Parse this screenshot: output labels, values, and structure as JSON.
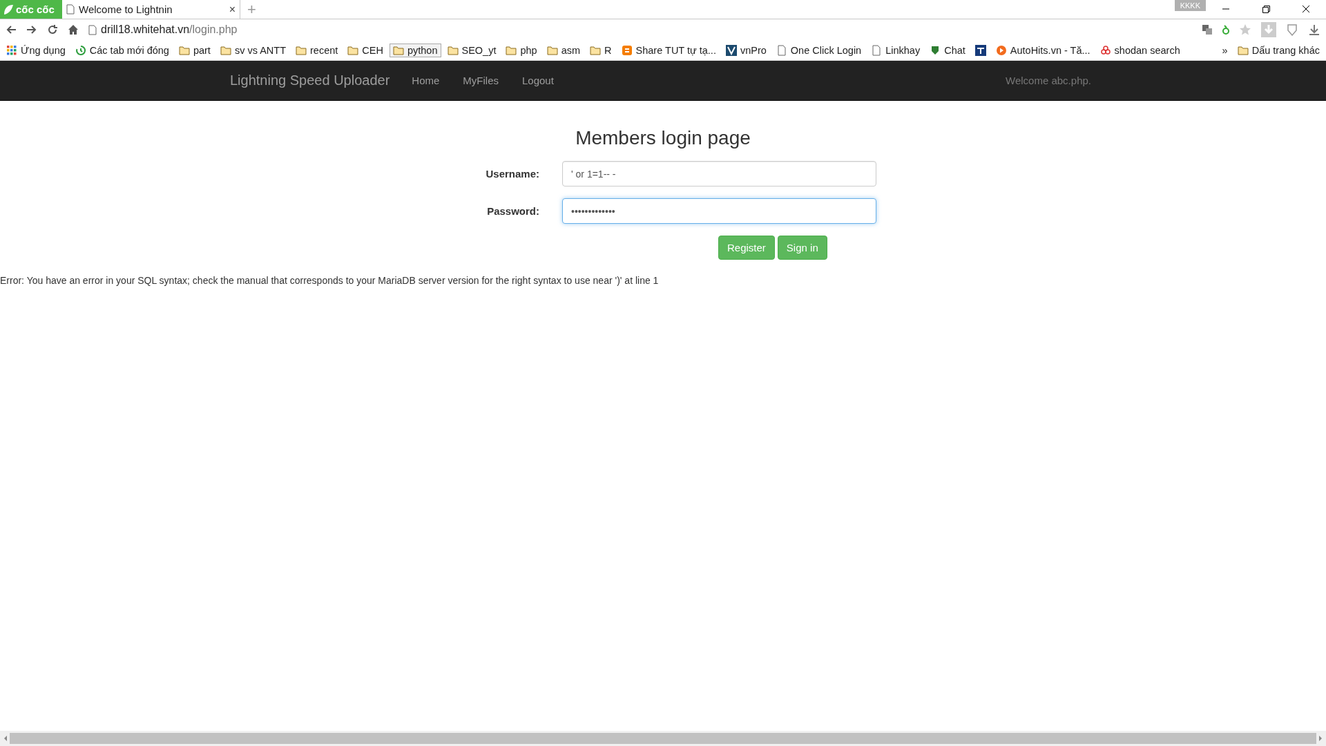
{
  "browser": {
    "logo": "cốc cốc",
    "tab": {
      "title": "Welcome to Lightnin",
      "close": "×"
    },
    "new_tab": "+",
    "profile": "KKKK",
    "address": {
      "host": "drill18.whitehat.vn",
      "path": "/login.php"
    }
  },
  "bookmarks": [
    {
      "kind": "apps",
      "label": "Ứng dụng",
      "selected": false
    },
    {
      "kind": "history",
      "label": "Các tab mới đóng",
      "selected": false
    },
    {
      "kind": "folder",
      "label": "part",
      "selected": false
    },
    {
      "kind": "folder",
      "label": "sv vs ANTT",
      "selected": false
    },
    {
      "kind": "folder",
      "label": "recent",
      "selected": false
    },
    {
      "kind": "folder",
      "label": "CEH",
      "selected": false
    },
    {
      "kind": "folder",
      "label": "python",
      "selected": true
    },
    {
      "kind": "folder",
      "label": "SEO_yt",
      "selected": false
    },
    {
      "kind": "folder",
      "label": "php",
      "selected": false
    },
    {
      "kind": "folder",
      "label": "asm",
      "selected": false
    },
    {
      "kind": "folder",
      "label": "R",
      "selected": false
    },
    {
      "kind": "blogger",
      "label": "Share TUT tự tạ...",
      "selected": false
    },
    {
      "kind": "vnpro",
      "label": "vnPro",
      "selected": false
    },
    {
      "kind": "page",
      "label": "One Click Login",
      "selected": false
    },
    {
      "kind": "page",
      "label": "Linkhay",
      "selected": false
    },
    {
      "kind": "shield",
      "label": "Chat",
      "selected": false
    },
    {
      "kind": "tp",
      "selected": false
    },
    {
      "kind": "play",
      "label": "AutoHits.vn - Tă...",
      "selected": false
    },
    {
      "kind": "shodan",
      "label": "shodan search",
      "selected": false
    }
  ],
  "bookmarks_more": "»",
  "other_bookmarks": "Dấu trang khác",
  "navbar": {
    "brand": "Lightning Speed Uploader",
    "links": [
      "Home",
      "MyFiles",
      "Logout"
    ],
    "welcome": "Welcome abc.php."
  },
  "login": {
    "title": "Members login page",
    "fields": [
      {
        "label": "Username:",
        "value": "' or 1=1-- -",
        "focused": false
      },
      {
        "label": "Password:",
        "value": "•••••••••••••",
        "focused": true
      }
    ],
    "buttons": [
      "Register",
      "Sign in"
    ]
  },
  "error": "Error: You have an error in your SQL syntax; check the manual that corresponds to your MariaDB server version for the right syntax to use near ')' at line 1"
}
